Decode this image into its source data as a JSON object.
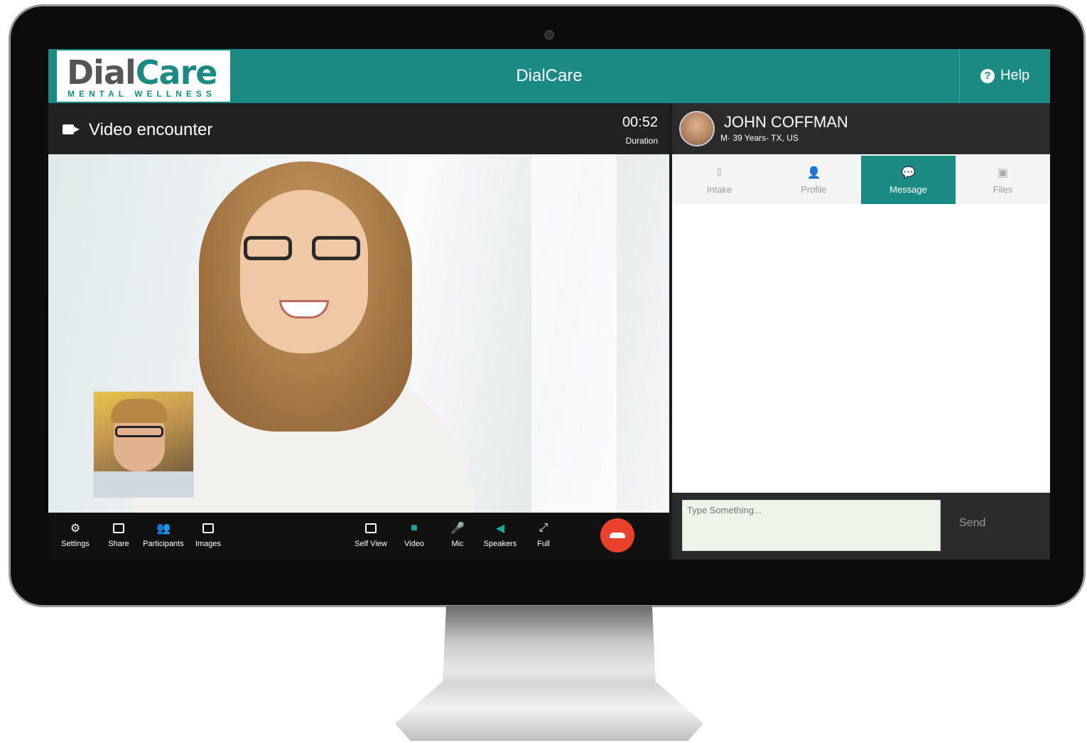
{
  "header": {
    "logo_main_a": "Dial",
    "logo_main_b": "Care",
    "logo_sub": "MENTAL WELLNESS",
    "title": "DialCare",
    "help_label": "Help"
  },
  "video": {
    "title": "Video encounter",
    "duration_value": "00:52",
    "duration_label": "Duration"
  },
  "toolbar": {
    "left_tools": [
      {
        "label": "Settings",
        "icon": "gear-icon"
      },
      {
        "label": "Share",
        "icon": "share-screen-icon"
      },
      {
        "label": "Participants",
        "icon": "participants-icon"
      },
      {
        "label": "Images",
        "icon": "image-icon"
      }
    ],
    "right_tools": [
      {
        "label": "Self View",
        "icon": "self-view-icon"
      },
      {
        "label": "Video",
        "icon": "video-camera-icon"
      },
      {
        "label": "Mic",
        "icon": "microphone-icon"
      },
      {
        "label": "Speakers",
        "icon": "speaker-icon"
      },
      {
        "label": "Full",
        "icon": "fullscreen-icon"
      }
    ],
    "end_call_icon": "end-call-icon"
  },
  "patient": {
    "name": "JOHN COFFMAN",
    "meta": "M· 39 Years- TX, US"
  },
  "tabs": [
    {
      "label": "Intake",
      "icon": "intake-icon",
      "active": false
    },
    {
      "label": "Profile",
      "icon": "profile-icon",
      "active": false
    },
    {
      "label": "Message",
      "icon": "message-icon",
      "active": true
    },
    {
      "label": "Files",
      "icon": "files-icon",
      "active": false
    }
  ],
  "compose": {
    "placeholder": "Type Something...",
    "value": "",
    "send_label": "Send"
  },
  "colors": {
    "accent": "#1a8a82",
    "end_call": "#e8412c",
    "active_icon": "#1aa79a"
  }
}
